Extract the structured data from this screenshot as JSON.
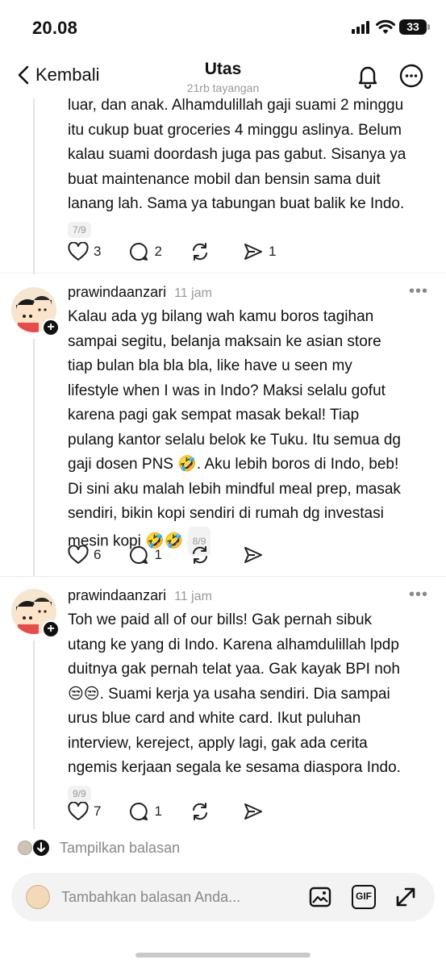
{
  "status_bar": {
    "time": "20.08",
    "battery": "33"
  },
  "header": {
    "back_label": "Kembali",
    "title": "Utas",
    "subtitle": "21rb tayangan"
  },
  "posts": [
    {
      "text_lines": [
        "luar, dan anak. Alhamdulillah gaji suami 2 minggu",
        "itu cukup buat groceries 4 minggu aslinya. Belum",
        "kalau suami doordash juga pas gabut. Sisanya ya",
        "buat maintenance mobil dan bensin sama duit",
        "lanang lah. Sama ya tabungan buat balik ke Indo."
      ],
      "page": "7/9",
      "likes": "3",
      "replies": "2",
      "reposts": "",
      "shares": "1"
    },
    {
      "username": "prawindaanzari",
      "time": "11 jam",
      "text_lines": [
        "Kalau ada yg bilang wah kamu boros tagihan",
        "sampai segitu, belanja maksain ke asian store",
        "tiap bulan bla bla bla, like have u seen my",
        "lifestyle when I was in Indo? Maksi selalu gofut",
        "karena pagi gak sempat masak bekal! Tiap",
        "pulang kantor selalu belok ke Tuku. Itu semua dg",
        "gaji dosen PNS 🤣. Aku lebih boros di Indo, beb!",
        "Di sini aku malah lebih mindful meal prep, masak",
        "sendiri, bikin kopi sendiri di rumah dg investasi",
        "mesin kopi 🤣🤣"
      ],
      "page": "8/9",
      "likes": "6",
      "replies": "1",
      "reposts": "",
      "shares": ""
    },
    {
      "username": "prawindaanzari",
      "time": "11 jam",
      "text_lines": [
        "Toh we paid all of our bills! Gak pernah sibuk",
        "utang ke yang di Indo. Karena alhamdulillah lpdp",
        "duitnya gak pernah telat yaa. Gak kayak BPI noh",
        "😒😒. Suami kerja ya usaha sendiri. Dia sampai",
        "urus blue card and white card. Ikut puluhan",
        "interview, kereject, apply lagi, gak ada cerita",
        "ngemis kerjaan segala ke sesama diaspora Indo."
      ],
      "page": "9/9",
      "likes": "7",
      "replies": "1",
      "reposts": "",
      "shares": ""
    }
  ],
  "show_replies_label": "Tampilkan balasan",
  "reply_bar": {
    "placeholder": "Tambahkan balasan Anda...",
    "gif_label": "GIF"
  }
}
